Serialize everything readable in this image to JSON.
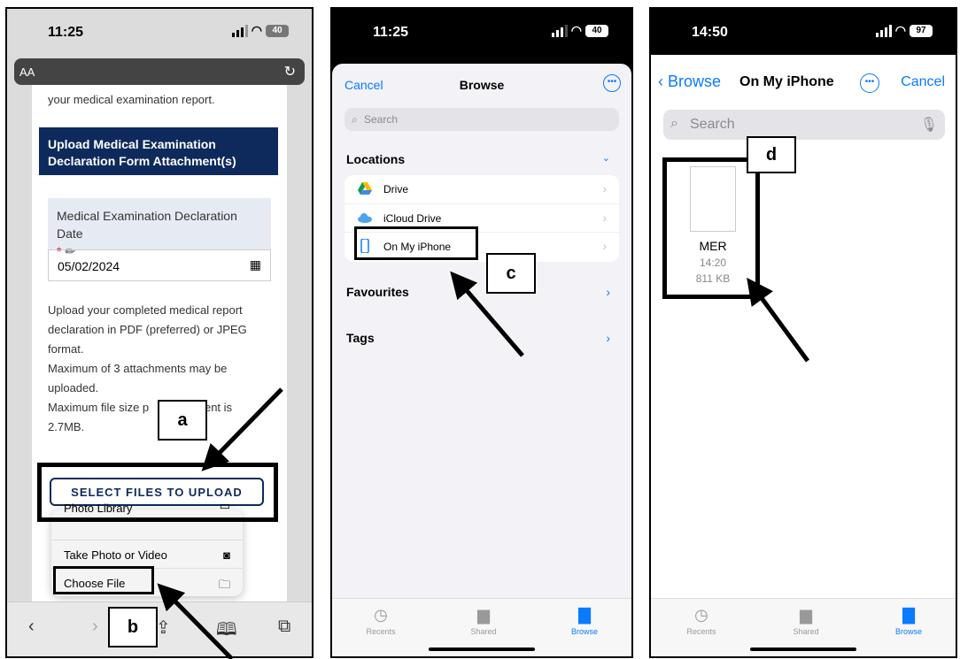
{
  "panel1": {
    "status": {
      "time": "11:25",
      "battery": "40"
    },
    "urlbar": {
      "aa": "AA"
    },
    "intro_text": "your medical examination report.",
    "section_header": "Upload Medical Examination Declaration Form Attachment(s)",
    "date_field": {
      "label": "Medical Examination Declaration Date",
      "required_mark": "*",
      "value": "05/02/2024"
    },
    "instructions": [
      "Upload your completed medical report declaration in PDF (preferred) or JPEG format.",
      "Maximum of 3 attachments may be uploaded.",
      "Maximum file size per attachment is 2.7MB."
    ],
    "instructions_visible": [
      "Upload your completed medical report",
      "declaration in PDF (preferred) or JPEG",
      "format.",
      "Maximum of 3 attachments may be",
      "uploaded.",
      "Maximum file size p",
      "ment is",
      "2.7MB."
    ],
    "upload_button": "SELECT FILES TO UPLOAD",
    "menu": [
      {
        "label": "Photo Library",
        "icon": "photo-icon"
      },
      {
        "label": "Take Photo or Video",
        "icon": "camera-icon"
      },
      {
        "label": "Choose File",
        "icon": "folder-icon"
      }
    ],
    "callouts": {
      "a": "a",
      "b": "b"
    }
  },
  "panel2": {
    "status": {
      "time": "11:25",
      "battery": "40"
    },
    "nav": {
      "cancel": "Cancel",
      "title": "Browse"
    },
    "search_placeholder": "Search",
    "locations_header": "Locations",
    "locations": [
      {
        "label": "Drive",
        "icon": "google-drive-icon"
      },
      {
        "label": "iCloud Drive",
        "icon": "icloud-icon"
      },
      {
        "label": "On My iPhone",
        "icon": "iphone-icon"
      }
    ],
    "favourites": "Favourites",
    "tags": "Tags",
    "tabs": [
      {
        "label": "Recents"
      },
      {
        "label": "Shared"
      },
      {
        "label": "Browse"
      }
    ],
    "callout": "c"
  },
  "panel3": {
    "status": {
      "time": "14:50",
      "battery": "97"
    },
    "nav": {
      "back": "Browse",
      "title": "On My iPhone",
      "cancel": "Cancel"
    },
    "search_placeholder": "Search",
    "file": {
      "name": "MER",
      "time": "14:20",
      "size": "811 KB"
    },
    "tabs": [
      {
        "label": "Recents"
      },
      {
        "label": "Shared"
      },
      {
        "label": "Browse"
      }
    ],
    "callout": "d"
  },
  "colors": {
    "navy": "#0e2a5c",
    "ios_blue": "#0a7aff"
  }
}
